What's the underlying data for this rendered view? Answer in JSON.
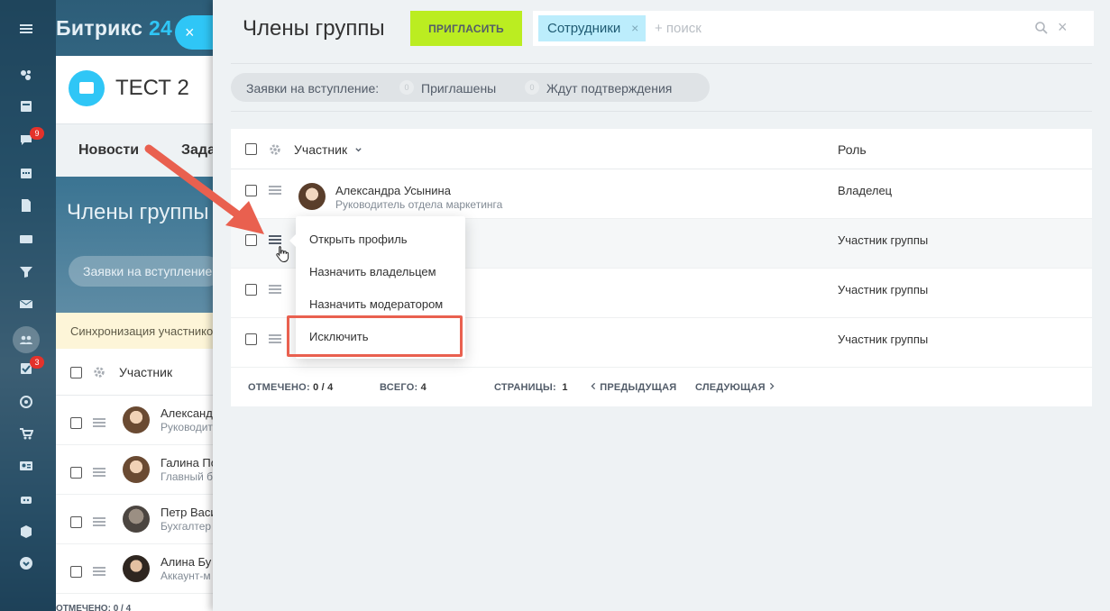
{
  "app": {
    "brand_name": "Битрикс",
    "brand_num": "24",
    "close_icon": "×"
  },
  "left_rail": {
    "icons": [
      "activity-icon",
      "feed-icon",
      "chat-icon",
      "calendar-icon",
      "docs-icon",
      "drive-icon",
      "crm-icon",
      "mail-icon",
      "groups-icon",
      "tasks-icon",
      "targets-icon",
      "shop-icon",
      "contacts-icon",
      "robots-icon",
      "box-icon",
      "more-icon"
    ],
    "badges": {
      "chat": "9",
      "tasks": "3"
    }
  },
  "background": {
    "group_name": "ТЕСТ 2",
    "tab_news": "Новости",
    "tab_tasks": "Зада",
    "page_title": "Члены группы",
    "requests": "Заявки на вступление",
    "sync_banner": "Синхронизация участников",
    "list_header": "Участник",
    "rows": [
      {
        "name": "Александ",
        "post": "Руководит"
      },
      {
        "name": "Галина По",
        "post": "Главный б"
      },
      {
        "name": "Петр Васи",
        "post": "Бухгалтер"
      },
      {
        "name": "Алина Бу",
        "post": "Аккаунт-м"
      }
    ],
    "footer": "ОТМЕЧЕНО: 0 / 4"
  },
  "panel": {
    "title": "Члены группы",
    "invite_label": "ПРИГЛАСИТЬ",
    "filter_chip": "Сотрудники",
    "chip_close": "×",
    "search_placeholder": "+ поиск",
    "search_clear": "×",
    "requests": {
      "label": "Заявки на вступление:",
      "invited_count": "0",
      "invited_label": "Приглашены",
      "pending_count": "0",
      "pending_label": "Ждут подтверждения"
    }
  },
  "table": {
    "col_participant": "Участник",
    "col_role": "Роль",
    "rows": [
      {
        "name": "Александра Усынина",
        "post": "Руководитель отдела маркетинга",
        "role": "Владелец"
      },
      {
        "name": "",
        "post": "",
        "role": "Участник группы"
      },
      {
        "name": "",
        "post": "",
        "role": "Участник группы"
      },
      {
        "name": "",
        "post": "",
        "role": "Участник группы"
      }
    ],
    "footer": {
      "checked_label": "ОТМЕЧЕНО:",
      "checked_value": "0 / 4",
      "total_label": "ВСЕГО:",
      "total_value": "4",
      "pages_label": "СТРАНИЦЫ:",
      "pages_value": "1",
      "prev": "ПРЕДЫДУЩАЯ",
      "next": "СЛЕДУЮЩАЯ"
    }
  },
  "context_menu": {
    "items": [
      "Открыть профиль",
      "Назначить владельцем",
      "Назначить модератором",
      "Исключить"
    ],
    "highlighted_item": "Исключить"
  },
  "colors": {
    "accent_blue": "#2fc6f6",
    "invite_green": "#bbed21",
    "annotation_red": "#e9604f"
  }
}
